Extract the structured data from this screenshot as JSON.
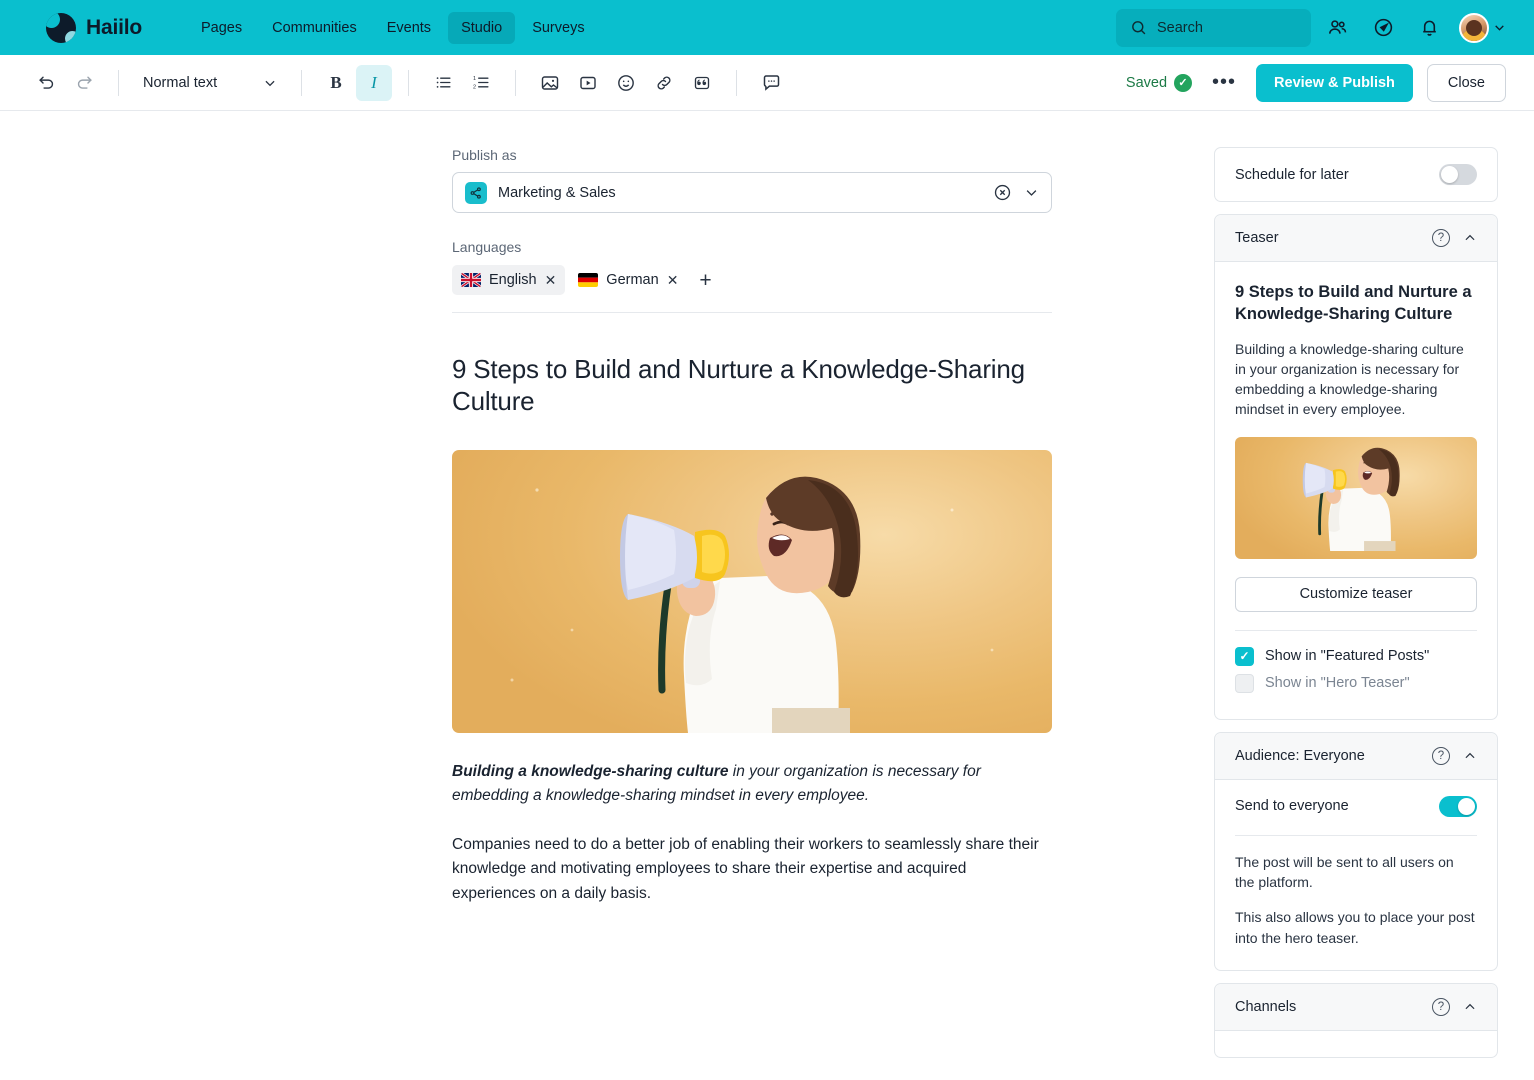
{
  "nav": {
    "brand": "Haiilo",
    "links": [
      {
        "label": "Pages",
        "active": false
      },
      {
        "label": "Communities",
        "active": false
      },
      {
        "label": "Events",
        "active": false
      },
      {
        "label": "Studio",
        "active": true
      },
      {
        "label": "Surveys",
        "active": false
      }
    ],
    "search_placeholder": "Search",
    "icons": [
      "people-icon",
      "compass-icon",
      "bell-icon"
    ]
  },
  "toolbar": {
    "undo": "undo-icon",
    "redo": "redo-icon",
    "style_value": "Normal text",
    "bold_label": "B",
    "italic_label": "I",
    "saved_label": "Saved",
    "more_label": "•••",
    "review_label": "Review & Publish",
    "close_label": "Close"
  },
  "editor": {
    "publish_as_label": "Publish as",
    "publish_as_value": "Marketing & Sales",
    "languages_label": "Languages",
    "languages": [
      {
        "label": "English",
        "flag": "uk-flag",
        "selected": true
      },
      {
        "label": "German",
        "flag": "german-flag",
        "selected": false
      }
    ],
    "add_language": "+",
    "title": "9 Steps to Build and Nurture a Knowledge-Sharing Culture",
    "lead_bold": "Building a knowledge-sharing culture",
    "lead_rest": " in your organization is necessary for embedding a knowledge-sharing mindset in every employee.",
    "paragraph": "Companies need to do a better job of enabling their workers to seamlessly share their knowledge and motivating employees to share their expertise and acquired experiences on a daily basis."
  },
  "sidebar": {
    "schedule_label": "Schedule for later",
    "schedule_on": false,
    "teaser": {
      "header": "Teaser",
      "title": "9 Steps to Build and Nurture a Knowledge-Sharing Culture",
      "description": "Building a knowledge-sharing culture in your organization is necessary for embedding a knowledge-sharing mindset in every employee.",
      "customize_label": "Customize teaser",
      "checks": [
        {
          "label": "Show in \"Featured Posts\"",
          "checked": true,
          "disabled": false
        },
        {
          "label": "Show in \"Hero Teaser\"",
          "checked": false,
          "disabled": true
        }
      ]
    },
    "audience": {
      "header": "Audience: Everyone",
      "toggle_label": "Send to everyone",
      "toggle_on": true,
      "info1": "The post will be sent to all users on the platform.",
      "info2": "This also allows you to place your post into the hero teaser."
    },
    "channels": {
      "header": "Channels"
    }
  },
  "colors": {
    "brand_teal": "#0ABFCE",
    "saved_green": "#23a45e",
    "chip_selected_bg": "#f0f1f3"
  }
}
